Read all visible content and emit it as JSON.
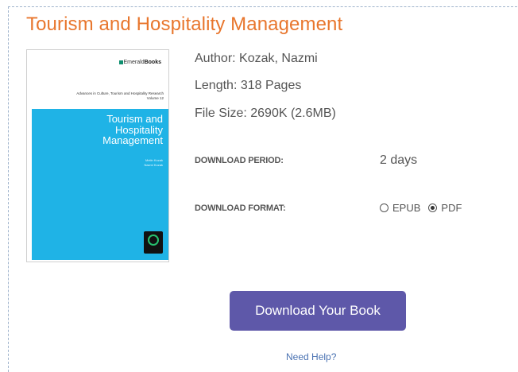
{
  "book": {
    "title": "Tourism and Hospitality Management",
    "author": "Author: Kozak, Nazmi",
    "length": "Length: 318 Pages",
    "file_size": "File Size: 2690K (2.6MB)"
  },
  "cover": {
    "brand_prefix": "Emerald",
    "brand_name": "Books",
    "series_line": "Advances in Culture, Tourism and Hospitality Research",
    "volume": "Volume 12",
    "title_line1": "Tourism and",
    "title_line2": "Hospitality",
    "title_line3": "Management",
    "authors_line1": "Metin Kozak",
    "authors_line2": "Nazmi Kozak",
    "band_color": "#1fb3e6"
  },
  "download": {
    "period_label": "DOWNLOAD PERIOD:",
    "period_value": "2 days",
    "format_label": "DOWNLOAD FORMAT:",
    "formats": [
      {
        "label": "EPUB",
        "selected": false
      },
      {
        "label": "PDF",
        "selected": true
      }
    ],
    "button_label": "Download Your Book",
    "help_link": "Need Help?"
  },
  "colors": {
    "title": "#e8762d",
    "button": "#5e58a9",
    "link": "#4a72b2"
  }
}
